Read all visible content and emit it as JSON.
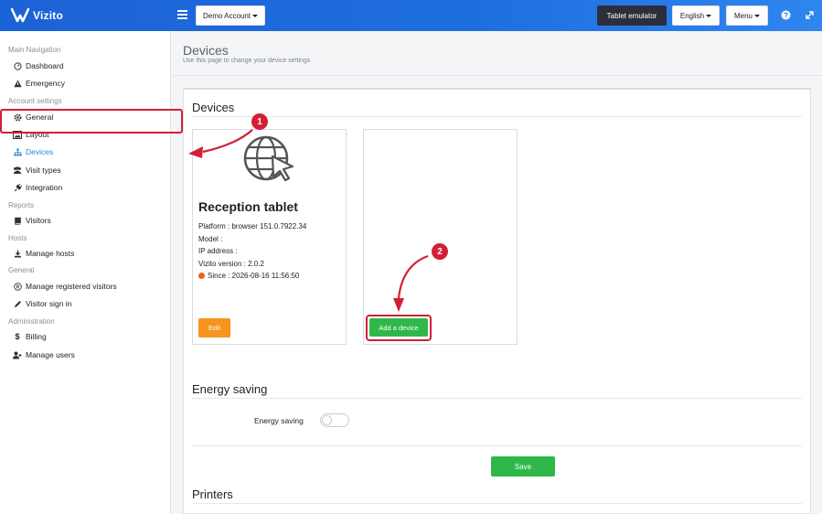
{
  "brand": {
    "name": "Vizito"
  },
  "header": {
    "account_label": "Demo Account",
    "tablet_emulator_label": "Tablet emulator",
    "language_label": "English",
    "menu_label": "Menu",
    "help_icon": "question-icon",
    "fullscreen_icon": "expand-icon"
  },
  "sidebar": {
    "sections": {
      "main_navigation": "Main Navigation",
      "account_settings": "Account settings",
      "reports": "Reports",
      "hosts": "Hosts",
      "general": "General",
      "administration": "Administration"
    },
    "items": {
      "dashboard": "Dashboard",
      "emergency": "Emergency",
      "general": "General",
      "layout": "Layout",
      "devices": "Devices",
      "visit_types": "Visit types",
      "integration": "Integration",
      "visitors": "Visitors",
      "manage_hosts": "Manage hosts",
      "manage_registered_visitors": "Manage registered visitors",
      "visitor_sign_in": "Visitor sign in",
      "billing": "Billing",
      "manage_users": "Manage users"
    },
    "active_item": "Devices"
  },
  "page": {
    "title": "Devices",
    "subtitle": "Use this page to change your device settings"
  },
  "devices_section": {
    "heading": "Devices",
    "device": {
      "name": "Reception tablet",
      "platform": "Platform : browser 151.0.7922.34",
      "model": "Model :",
      "ip_address": "IP address :",
      "version": "Vizito version : 2.0.2",
      "since": "Since : 2026-08-16 11:56:50",
      "edit_label": "Edit"
    },
    "add_device_label": "Add a device"
  },
  "energy_section": {
    "heading": "Energy saving",
    "toggle_label": "Energy saving",
    "toggle_on": false,
    "save_label": "Save"
  },
  "printers_section": {
    "heading": "Printers"
  },
  "annotations": {
    "step1": "1",
    "step2": "2"
  },
  "colors": {
    "topbar": "#1f6fe0",
    "accent_active": "#1f87e0",
    "annotation_red": "#d21f36",
    "edit_orange": "#f7941d",
    "add_green": "#2fb84a",
    "status_dot": "#e8641c"
  }
}
